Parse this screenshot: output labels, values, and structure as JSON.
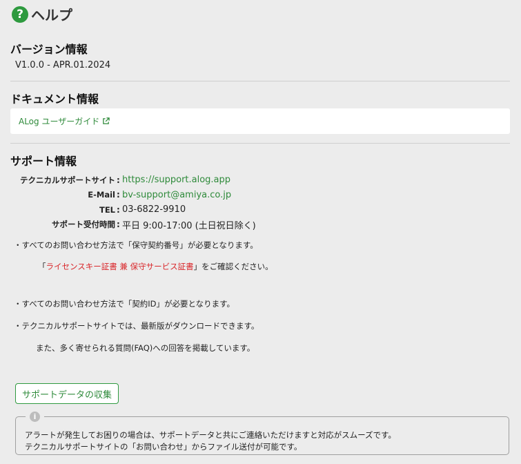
{
  "page": {
    "title": "ヘルプ"
  },
  "version": {
    "heading": "バージョン情報",
    "text": "V1.0.0 - APR.01.2024"
  },
  "document": {
    "heading": "ドキュメント情報",
    "link_label": "ALog ユーザーガイド"
  },
  "support": {
    "heading": "サポート情報",
    "rows": [
      {
        "label": "テクニカルサポートサイト",
        "value": "https://support.alog.app"
      },
      {
        "label": "E-Mail",
        "value": "bv-support@amiya.co.jp"
      },
      {
        "label": "TEL",
        "value": "03-6822-9910"
      },
      {
        "label": "サポート受付時間",
        "value": "平日 9:00-17:00 (土日祝日除く)"
      }
    ],
    "colon": ":",
    "notes": {
      "n1": "・すべてのお問い合わせ方法で「保守契約番号」が必要となります。",
      "n2_open": "「",
      "n2_red": "ライセンスキー証書 兼 保守サービス証書",
      "n2_close": "」をご確認ください。",
      "n3": "・すべてのお問い合わせ方法で「契約ID」が必要となります。",
      "n4": "・テクニカルサポートサイトでは、最新版がダウンロードできます。",
      "n5": "また、多く寄せられる質問(FAQ)への回答を掲載しています。"
    }
  },
  "collect_button": {
    "label": "サポートデータの収集"
  },
  "info_box": {
    "line1": "アラートが発生してお困りの場合は、サポートデータと共にご連絡いただけますと対応がスムーズです。",
    "line2": "テクニカルサポートサイトの「お問い合わせ」からファイル送付が可能です。"
  },
  "colors": {
    "accent": "#2e9a3f",
    "link": "#2e8a3a",
    "warning_text": "#d9262a",
    "background": "#ececec"
  },
  "icons": {
    "title": "question-circle-icon",
    "external": "external-link-icon",
    "info": "info-circle-icon"
  }
}
